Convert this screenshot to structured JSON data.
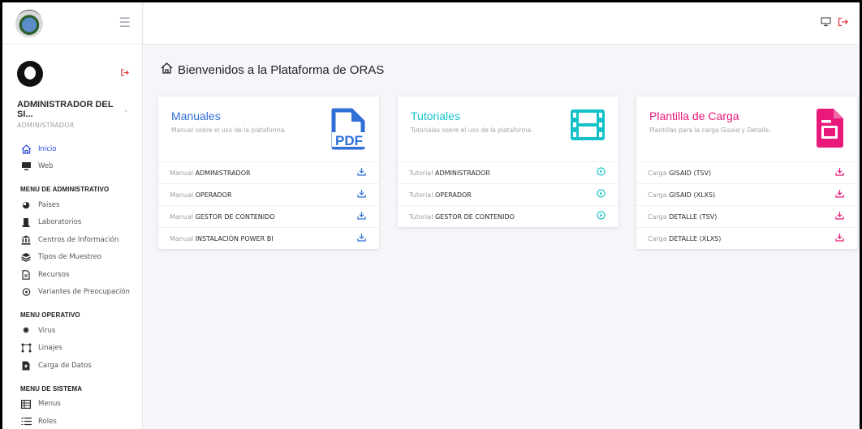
{
  "sidebar": {
    "user_name": "ADMINISTRADOR DEL SI...",
    "user_role": "ADMINISTRADOR",
    "main_items": [
      {
        "label": "Inicio",
        "icon": "home-icon"
      },
      {
        "label": "Web",
        "icon": "monitor-icon"
      }
    ],
    "sections": [
      {
        "heading": "MENU DE ADMINISTRATIVO",
        "items": [
          {
            "label": "Paises",
            "icon": "globe-icon"
          },
          {
            "label": "Laboratorios",
            "icon": "flask-icon"
          },
          {
            "label": "Centros de Información",
            "icon": "bank-icon"
          },
          {
            "label": "Tipos de Muestreo",
            "icon": "layers-icon"
          },
          {
            "label": "Recursos",
            "icon": "file-icon"
          },
          {
            "label": "Variantes de Preocupación",
            "icon": "virus-icon"
          }
        ]
      },
      {
        "heading": "MENU OPERATIVO",
        "items": [
          {
            "label": "Virus",
            "icon": "virus-icon"
          },
          {
            "label": "Linajes",
            "icon": "tree-icon"
          },
          {
            "label": "Carga de Datos",
            "icon": "upload-file-icon"
          }
        ]
      },
      {
        "heading": "MENU DE SISTEMA",
        "items": [
          {
            "label": "Menus",
            "icon": "table-icon"
          },
          {
            "label": "Roles",
            "icon": "list-icon"
          }
        ]
      }
    ]
  },
  "page": {
    "title": "Bienvenidos a la Plataforma de ORAS"
  },
  "cards": [
    {
      "title": "Manuales",
      "subtitle": "Manual sobre el uso de la plataforma.",
      "icon": "pdf-file-icon",
      "accent": "#2f6fd6",
      "rows": [
        {
          "prefix": "Manual",
          "name": "ADMINISTRADOR",
          "icon": "download-icon"
        },
        {
          "prefix": "Manual",
          "name": "OPERADOR",
          "icon": "download-icon"
        },
        {
          "prefix": "Manual",
          "name": "GESTOR DE CONTENIDO",
          "icon": "download-icon"
        },
        {
          "prefix": "Manual",
          "name": "INSTALACIÓN POWER BI",
          "icon": "download-icon"
        }
      ]
    },
    {
      "title": "Tutoriales",
      "subtitle": "Tutoriales sobre el uso de la plataforma.",
      "icon": "film-icon",
      "accent": "#16c2c9",
      "rows": [
        {
          "prefix": "Tutorial",
          "name": "ADMINISTRADOR",
          "icon": "play-icon"
        },
        {
          "prefix": "Tutorial",
          "name": "OPERADOR",
          "icon": "play-icon"
        },
        {
          "prefix": "Tutorial",
          "name": "GESTOR DE CONTENIDO",
          "icon": "play-icon"
        }
      ]
    },
    {
      "title": "Plantilla de Carga",
      "subtitle": "Plantillas para la carga Gisaid y Detalle.",
      "icon": "document-icon",
      "accent": "#e8197a",
      "rows": [
        {
          "prefix": "Carga",
          "name": "GISAID (TSV)",
          "icon": "download-icon"
        },
        {
          "prefix": "Carga",
          "name": "GISAID (XLXS)",
          "icon": "download-icon"
        },
        {
          "prefix": "Carga",
          "name": "DETALLE (TSV)",
          "icon": "download-icon"
        },
        {
          "prefix": "Carga",
          "name": "DETALLE (XLXS)",
          "icon": "download-icon"
        }
      ]
    }
  ]
}
